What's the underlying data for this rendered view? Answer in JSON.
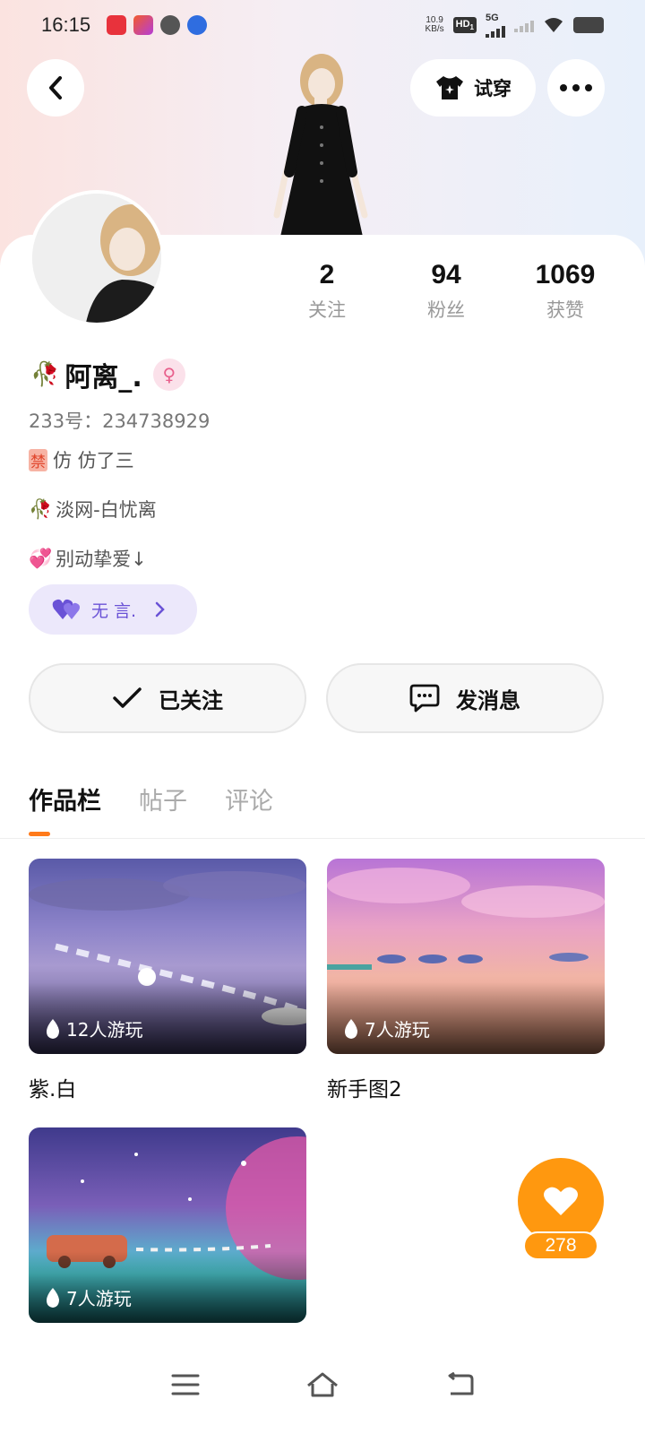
{
  "status_bar": {
    "time": "16:15",
    "net_speed_value": "10.9",
    "net_speed_unit": "KB/s",
    "hd_label": "HD",
    "hd_sub": "1",
    "signal_label": "5G"
  },
  "header": {
    "tryon_label": "试穿"
  },
  "stats": [
    {
      "value": "2",
      "label": "关注"
    },
    {
      "value": "94",
      "label": "粉丝"
    },
    {
      "value": "1069",
      "label": "获赞"
    }
  ],
  "profile": {
    "name_emoji": "🥀",
    "name": "阿离_.",
    "gender_symbol": "♀",
    "id_line": "233号：234738929",
    "ban_tag": "禁",
    "bio_line1": "仿  仿了三",
    "bio_line2_emoji": "🥀",
    "bio_line2": "淡网-白忧离",
    "bio_line3_emoji": "💞",
    "bio_line3": "别动挚爱↓",
    "group_label": "无 言."
  },
  "actions": {
    "follow_label": "已关注",
    "message_label": "发消息"
  },
  "tabs": [
    {
      "label": "作品栏",
      "active": true
    },
    {
      "label": "帖子",
      "active": false
    },
    {
      "label": "评论",
      "active": false
    }
  ],
  "games": [
    {
      "plays": "12人游玩",
      "title": "紫.白"
    },
    {
      "plays": "7人游玩",
      "title": "新手图2"
    },
    {
      "plays": "7人游玩",
      "title": ""
    }
  ],
  "like": {
    "count": "278"
  },
  "colors": {
    "accent_orange": "#ff980f",
    "tab_indicator": "#ff7a1a",
    "group_purple": "#6a52d6",
    "group_bg": "#ece8fb"
  }
}
